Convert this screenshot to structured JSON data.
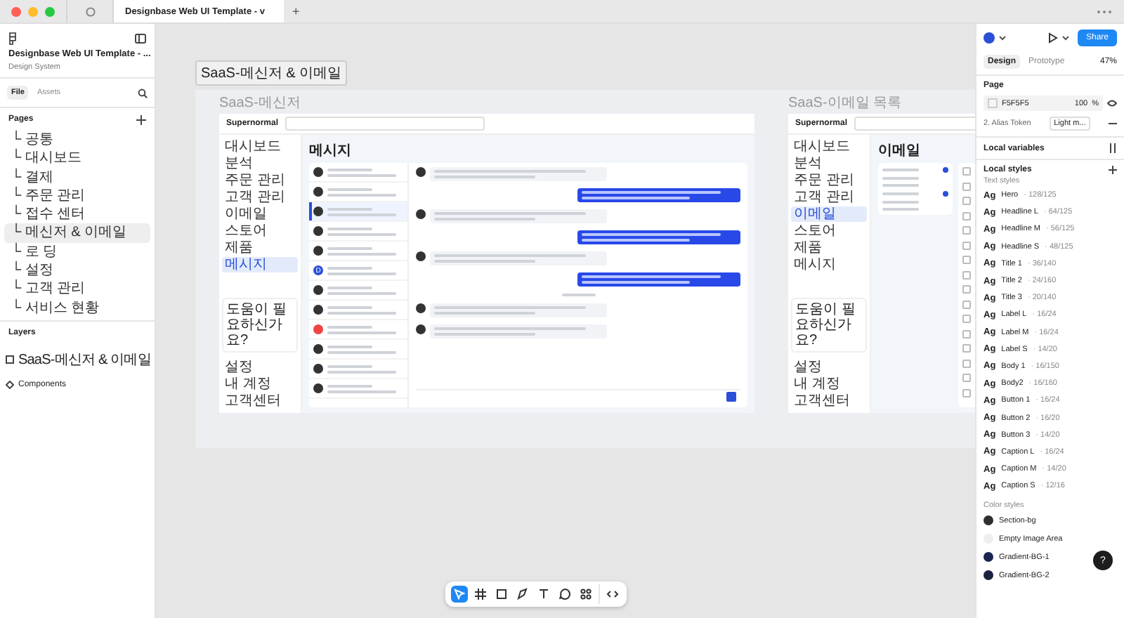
{
  "tabbar": {
    "file_tab": "Designbase Web UI Template - v",
    "new_tab": "+"
  },
  "left_panel": {
    "file_title": "Designbase Web UI Template - ...",
    "subtitle": "Design System",
    "tabs": [
      {
        "label": "File",
        "selected": true
      },
      {
        "label": "Assets",
        "selected": false
      }
    ],
    "pages_heading": "Pages",
    "pages": [
      {
        "label": "└ 공통",
        "selected": false
      },
      {
        "label": "└ 대시보드",
        "selected": false
      },
      {
        "label": "└ 결제",
        "selected": false
      },
      {
        "label": "└ 주문 관리",
        "selected": false
      },
      {
        "label": "└ 접수 센터",
        "selected": false
      },
      {
        "label": "└ 메신저 & 이메일",
        "selected": true
      },
      {
        "label": "└ 로 딩",
        "selected": false
      },
      {
        "label": "└ 설정",
        "selected": false
      },
      {
        "label": "└ 고객 관리",
        "selected": false
      },
      {
        "label": "└ 서비스 현황",
        "selected": false
      }
    ],
    "layers_heading": "Layers",
    "layers": [
      {
        "label": "SaaS-메신저 & 이메일",
        "kind": "frame"
      },
      {
        "label": "Components",
        "kind": "component"
      }
    ]
  },
  "canvas": {
    "section_label": "SaaS-메신저 & 이메일",
    "messenger": {
      "label": "SaaS-메신저",
      "brand": "Supernormal",
      "page_title": "메시지",
      "nav": [
        {
          "label": "대시보드",
          "selected": false
        },
        {
          "label": "분석",
          "selected": false
        },
        {
          "label": "주문 관리",
          "selected": false
        },
        {
          "label": "고객 관리",
          "selected": false
        },
        {
          "label": "이메일",
          "selected": false
        },
        {
          "label": "스토어",
          "selected": false
        },
        {
          "label": "제품",
          "selected": false
        },
        {
          "label": "메시지",
          "selected": true
        }
      ],
      "help_title": "도움이 필요하신가요?",
      "footer_nav": [
        "설정",
        "내 계정",
        "고객센터"
      ],
      "conversations": [
        {
          "kind": "person",
          "selected": false
        },
        {
          "kind": "person",
          "selected": false
        },
        {
          "kind": "person",
          "selected": true
        },
        {
          "kind": "person",
          "selected": false
        },
        {
          "kind": "person",
          "selected": false
        },
        {
          "kind": "letter",
          "initial": "D",
          "selected": false
        },
        {
          "kind": "person",
          "selected": false
        },
        {
          "kind": "person",
          "selected": false
        },
        {
          "kind": "alert",
          "selected": false
        },
        {
          "kind": "person",
          "selected": false
        },
        {
          "kind": "person",
          "selected": false
        },
        {
          "kind": "person",
          "selected": false
        }
      ],
      "messages": [
        {
          "kind": "incoming"
        },
        {
          "kind": "outgoing"
        },
        {
          "kind": "incoming"
        },
        {
          "kind": "outgoing"
        },
        {
          "kind": "incoming"
        },
        {
          "kind": "outgoing"
        },
        {
          "kind": "date"
        },
        {
          "kind": "incoming"
        },
        {
          "kind": "incoming"
        }
      ]
    },
    "email": {
      "label": "SaaS-이메일 목록",
      "brand": "Supernormal",
      "page_title": "이메일",
      "nav": [
        {
          "label": "대시보드",
          "selected": false
        },
        {
          "label": "분석",
          "selected": false
        },
        {
          "label": "주문 관리",
          "selected": false
        },
        {
          "label": "고객 관리",
          "selected": false
        },
        {
          "label": "이메일",
          "selected": true
        },
        {
          "label": "스토어",
          "selected": false
        },
        {
          "label": "제품",
          "selected": false
        },
        {
          "label": "메시지",
          "selected": false
        }
      ],
      "help_title": "도움이 필요하신가요?",
      "footer_nav": [
        "설정",
        "내 계정",
        "고객센터"
      ],
      "folders": [
        {
          "unread": true
        },
        {
          "unread": false
        },
        {
          "unread": false
        },
        {
          "unread": true
        },
        {
          "unread": false
        },
        {
          "unread": false
        }
      ]
    }
  },
  "toolbar": {
    "tools": [
      {
        "kind": "move",
        "selected": true
      },
      {
        "kind": "frame",
        "selected": false
      },
      {
        "kind": "shape",
        "selected": false
      },
      {
        "kind": "pen",
        "selected": false
      },
      {
        "kind": "text",
        "selected": false
      },
      {
        "kind": "comment",
        "selected": false
      },
      {
        "kind": "actions",
        "selected": false
      },
      {
        "kind": "dev",
        "selected": false
      }
    ]
  },
  "right_panel": {
    "share": "Share",
    "tabs": [
      {
        "label": "Design",
        "selected": true
      },
      {
        "label": "Prototype",
        "selected": false
      }
    ],
    "zoom": "47%",
    "page_heading": "Page",
    "fill_hex": "F5F5F5",
    "fill_opacity": "100",
    "fill_unit": "%",
    "alias_label": "2. Alias Token",
    "alias_value": "Light m...",
    "local_variables": "Local variables",
    "local_styles": "Local styles",
    "text_styles_heading": "Text styles",
    "text_styles": [
      {
        "glyph": "Ag",
        "name": "Hero",
        "spec": "· 128/125"
      },
      {
        "glyph": "Ag",
        "name": "Headline L",
        "spec": "· 64/125"
      },
      {
        "glyph": "Ag",
        "name": "Headline M",
        "spec": "· 56/125"
      },
      {
        "glyph": "Ag",
        "name": "Headline S",
        "spec": "· 48/125"
      },
      {
        "glyph": "Ag",
        "name": "Title 1",
        "spec": "· 36/140"
      },
      {
        "glyph": "Ag",
        "name": "Title 2",
        "spec": "· 24/160"
      },
      {
        "glyph": "Ag",
        "name": "Title 3",
        "spec": "· 20/140"
      },
      {
        "glyph": "Ag",
        "name": "Label L",
        "spec": "· 16/24"
      },
      {
        "glyph": "Ag",
        "name": "Label M",
        "spec": "· 16/24"
      },
      {
        "glyph": "Ag",
        "name": "Label S",
        "spec": "· 14/20"
      },
      {
        "glyph": "Ag",
        "name": "Body 1",
        "spec": "· 16/150"
      },
      {
        "glyph": "Ag",
        "name": "Body2",
        "spec": "· 16/160"
      },
      {
        "glyph": "Ag",
        "name": "Button 1",
        "spec": "· 16/24"
      },
      {
        "glyph": "Ag",
        "name": "Button 2",
        "spec": "· 16/20"
      },
      {
        "glyph": "Ag",
        "name": "Button 3",
        "spec": "· 14/20"
      },
      {
        "glyph": "Ag",
        "name": "Caption L",
        "spec": "· 16/24"
      },
      {
        "glyph": "Ag",
        "name": "Caption M",
        "spec": "· 14/20"
      },
      {
        "glyph": "Ag",
        "name": "Caption S",
        "spec": "· 12/16"
      }
    ],
    "color_styles_heading": "Color styles",
    "color_styles": [
      {
        "name": "Section-bg",
        "color": "#2f2f2f"
      },
      {
        "name": "Empty Image Area",
        "color": "#eeeeee"
      },
      {
        "name": "Gradient-BG-1",
        "color": "#1b2550"
      },
      {
        "name": "Gradient-BG-2",
        "color": "#1a2240"
      }
    ],
    "help": "?"
  }
}
